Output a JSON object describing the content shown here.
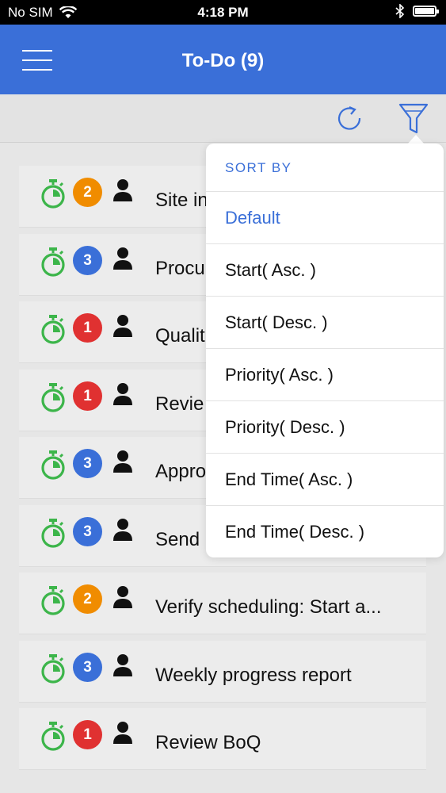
{
  "status_bar": {
    "carrier": "No SIM",
    "time": "4:18 PM",
    "battery_level": 1.0
  },
  "header": {
    "title": "To-Do (9)"
  },
  "icons": {
    "menu": "hamburger-menu-icon",
    "refresh": "refresh-icon",
    "filter": "filter-icon",
    "timer": "stopwatch-icon",
    "person": "person-icon"
  },
  "colors": {
    "accent": "#3a6fd8",
    "timer": "#3cb54a",
    "priority_1": "#e03131",
    "priority_2": "#f08c00",
    "priority_3": "#3a6fd8"
  },
  "tasks": [
    {
      "priority": "2",
      "title": "Site in"
    },
    {
      "priority": "3",
      "title": "Procu"
    },
    {
      "priority": "1",
      "title": "Qualit"
    },
    {
      "priority": "1",
      "title": "Revie"
    },
    {
      "priority": "3",
      "title": "Appro"
    },
    {
      "priority": "3",
      "title": "Send"
    },
    {
      "priority": "2",
      "title": "Verify scheduling: Start a..."
    },
    {
      "priority": "3",
      "title": "Weekly progress report"
    },
    {
      "priority": "1",
      "title": "Review BoQ"
    }
  ],
  "sort_menu": {
    "header": "SORT BY",
    "selected": "Default",
    "options": [
      "Default",
      "Start( Asc. )",
      "Start( Desc. )",
      "Priority( Asc. )",
      "Priority( Desc. )",
      "End Time( Asc. )",
      "End Time( Desc. )"
    ]
  }
}
